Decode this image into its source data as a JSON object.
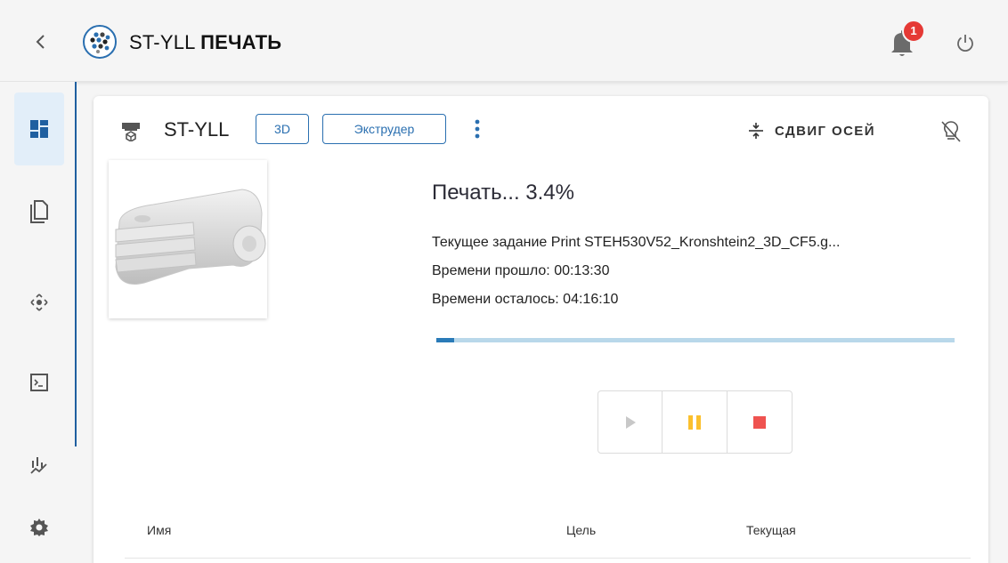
{
  "header": {
    "title_prefix": "ST-YLL",
    "title_bold": "ПЕЧАТЬ",
    "notification_count": "1",
    "icons": [
      "chevron-left-icon",
      "logo-icon",
      "bell-icon",
      "power-icon"
    ]
  },
  "sidebar": {
    "items": [
      {
        "name": "dashboard",
        "icon": "dashboard-icon",
        "active": true
      },
      {
        "name": "files",
        "icon": "files-icon"
      },
      {
        "name": "move",
        "icon": "move-arrows-icon"
      },
      {
        "name": "console",
        "icon": "console-icon"
      },
      {
        "name": "history",
        "icon": "chart-icon"
      },
      {
        "name": "settings",
        "icon": "gear-icon"
      }
    ]
  },
  "card": {
    "printer_name": "ST-YLL",
    "chips": [
      "3D",
      "Экструдер"
    ],
    "shift_axes_label": "СДВИГ ОСЕЙ",
    "status_title": "Печать... 3.4%",
    "current_job": "Текущее задание Print STEH530V52_Kronshtein2_3D_CF5.g...",
    "elapsed": "Времени прошло: 00:13:30",
    "remaining": "Времени осталось: 04:16:10",
    "progress_fraction": 0.034,
    "controls": [
      "play-icon",
      "pause-icon",
      "stop-icon"
    ],
    "table_headers": {
      "name": "Имя",
      "target": "Цель",
      "current": "Текущая"
    }
  },
  "colors": {
    "accent": "#2a6fb0",
    "pause": "#fbc02d",
    "stop": "#ef5350",
    "badge": "#e53935",
    "progress": "#2a7bb8"
  }
}
